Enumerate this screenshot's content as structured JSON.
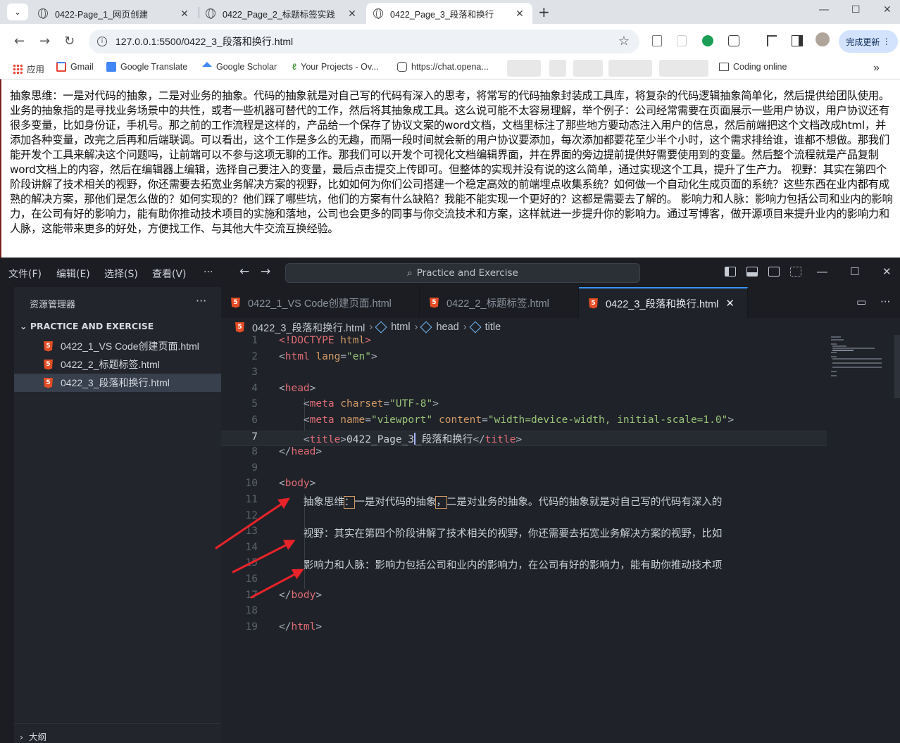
{
  "browser": {
    "tabs": [
      {
        "label": "0422-Page_1_网页创建",
        "active": false
      },
      {
        "label": "0422_Page_2_标题标签实践",
        "active": false
      },
      {
        "label": "0422_Page_3_段落和换行",
        "active": true
      }
    ],
    "url": "127.0.0.1:5500/0422_3_段落和换行.html",
    "update_button": "完成更新",
    "bookmarks": [
      {
        "label": "应用",
        "icon": "apps-grid-icon"
      },
      {
        "label": "Gmail",
        "icon": "gmail-icon"
      },
      {
        "label": "Google Translate",
        "icon": "translate-icon"
      },
      {
        "label": "Google Scholar",
        "icon": "scholar-icon"
      },
      {
        "label": "Your Projects - Ov...",
        "icon": "overleaf-icon"
      },
      {
        "label": "https://chat.opena...",
        "icon": "openai-icon"
      },
      {
        "label": "Coding online",
        "icon": "folder-icon"
      }
    ]
  },
  "page": {
    "paragraph": "抽象思维：一是对代码的抽象，二是对业务的抽象。代码的抽象就是对自己写的代码有深入的思考，将常写的代码抽象封装成工具库，将复杂的代码逻辑抽象简单化，然后提供给团队使用。业务的抽象指的是寻找业务场景中的共性，或者一些机器可替代的工作，然后将其抽象成工具。这么说可能不太容易理解，举个例子：公司经常需要在页面展示一些用户协议，用户协议还有很多变量，比如身份证，手机号。那之前的工作流程是这样的，产品给一个保存了协议文案的word文档，文档里标注了那些地方要动态注入用户的信息，然后前端把这个文档改成html，并添加各种变量，改完之后再和后端联调。可以看出，这个工作是多么的无趣，而隔一段时间就会新的用户协议要添加，每次添加都要花至少半个小时，这个需求排给谁，谁都不想做。那我们能开发个工具来解决这个问题吗，让前端可以不参与这项无聊的工作。那我们可以开发个可视化文档编辑界面，并在界面的旁边提前提供好需要使用到的变量。然后整个流程就是产品复制word文档上的内容，然后在编辑器上编辑，选择自己要注入的变量，最后点击提交上传即可。但整体的实现并没有说的这么简单，通过实现这个工具，提升了生产力。 视野：其实在第四个阶段讲解了技术相关的视野，你还需要去拓宽业务解决方案的视野，比如如何为你们公司搭建一个稳定高效的前端埋点收集系统？如何做一个自动化生成页面的系统？这些东西在业内都有成熟的解决方案，那他们是怎么做的？如何实现的？他们踩了哪些坑，他们的方案有什么缺陷？我能不能实现一个更好的？这都是需要去了解的。 影响力和人脉：影响力包括公司和业内的影响力，在公司有好的影响力，能有助你推动技术项目的实施和落地，公司也会更多的同事与你交流技术和方案，这样就进一步提升你的影响力。通过写博客，做开源项目来提升业内的影响力和人脉，这能带来更多的好处，方便找工作、与其他大牛交流互换经验。"
  },
  "vscode": {
    "menu": [
      "文件(F)",
      "编辑(E)",
      "选择(S)",
      "查看(V)",
      "···"
    ],
    "command_center": "Practice and Exercise",
    "explorer_title": "资源管理器",
    "section": "PRACTICE AND EXERCISE",
    "files": [
      {
        "name": "0422_1_VS Code创建页面.html",
        "selected": false
      },
      {
        "name": "0422_2_标题标签.html",
        "selected": false
      },
      {
        "name": "0422_3_段落和换行.html",
        "selected": true
      }
    ],
    "outline": "大纲",
    "editor_tabs": [
      {
        "name": "0422_1_VS Code创建页面.html",
        "active": false
      },
      {
        "name": "0422_2_标题标签.html",
        "active": false
      },
      {
        "name": "0422_3_段落和换行.html",
        "active": true
      }
    ],
    "breadcrumb": [
      "0422_3_段落和换行.html",
      "html",
      "head",
      "title"
    ],
    "current_line": 7,
    "lines": {
      "l1a": "<!DOCTYPE",
      "l1b": " html",
      "l1c": ">",
      "l2a": "<",
      "l2b": "html",
      "l2c": " lang",
      "l2d": "=",
      "l2e": "\"en\"",
      "l2f": ">",
      "l4": "head",
      "l5a": "meta",
      "l5b": " charset",
      "l5c": "\"UTF-8\"",
      "l6a": "meta",
      "l6b": " name",
      "l6c": "\"viewport\"",
      "l6d": " content",
      "l6e": "\"width=device-width, initial-scale=1.0\"",
      "l7a": "title",
      "l7b": "0422_Page_3",
      "l7c": "_段落和换行",
      "l7d": "title",
      "l8": "head",
      "l10": "body",
      "l11a": "抽象思维",
      "l11b": "：",
      "l11c": "一是对代码的抽象",
      "l11d": "，",
      "l11e": "二是对业务的抽象。代码的抽象就是对自己写的代码有深入的",
      "l13": "视野：其实在第四个阶段讲解了技术相关的视野，你还需要去拓宽业务解决方案的视野，比如",
      "l15": "影响力和人脉：影响力包括公司和业内的影响力，在公司有好的影响力，能有助你推动技术项",
      "l17": "body",
      "l19": "html"
    },
    "line_numbers": [
      "1",
      "2",
      "3",
      "4",
      "5",
      "6",
      "7",
      "8",
      "9",
      "10",
      "11",
      "12",
      "13",
      "14",
      "15",
      "16",
      "17",
      "18",
      "19"
    ]
  }
}
